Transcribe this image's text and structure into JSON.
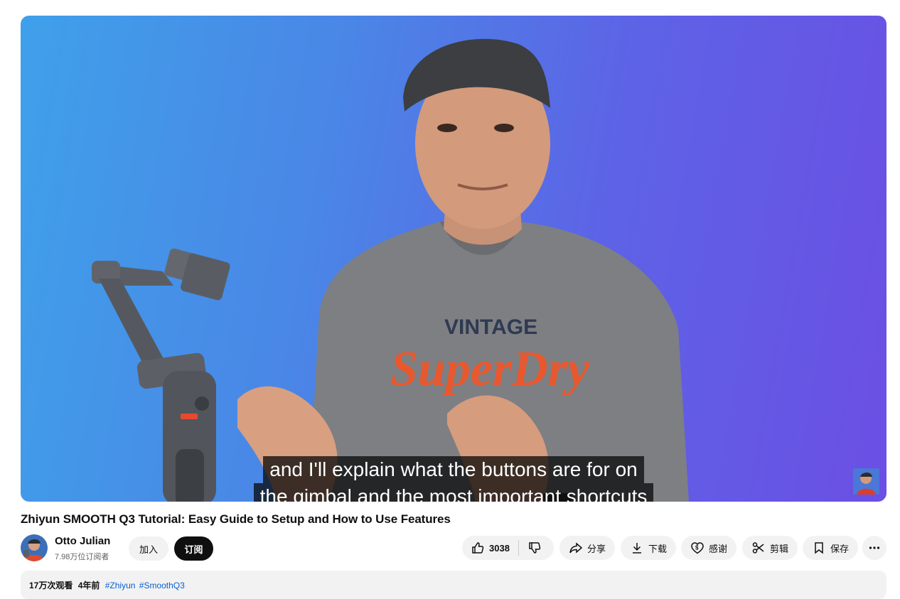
{
  "video": {
    "caption_lines": [
      "and I'll explain what the buttons are for on",
      "the gimbal and the most important shortcuts"
    ],
    "shirt_text": "VINTAGE",
    "shirt_logo": "SuperDry"
  },
  "title": "Zhiyun SMOOTH Q3 Tutorial: Easy Guide to Setup and How to Use Features",
  "channel": {
    "name": "Otto Julian",
    "subscribers": "7.98万位订阅者",
    "join_label": "加入",
    "subscribe_label": "订阅"
  },
  "actions": {
    "like_count": "3038",
    "share_label": "分享",
    "download_label": "下载",
    "thanks_label": "感谢",
    "clip_label": "剪辑",
    "save_label": "保存"
  },
  "description": {
    "views": "17万次观看",
    "age": "4年前",
    "tags": [
      "#Zhiyun",
      "#SmoothQ3"
    ]
  },
  "colors": {
    "subscribe_bg": "#0f0f0f",
    "pill_bg": "#f2f2f2",
    "hashtag": "#065fd4",
    "player_blue": "#3fa0ea",
    "player_purple": "#6b4fe4"
  },
  "icons": [
    "thumb-up-icon",
    "thumb-down-icon",
    "share-icon",
    "download-icon",
    "thanks-icon",
    "scissors-icon",
    "bookmark-icon",
    "more-icon"
  ]
}
